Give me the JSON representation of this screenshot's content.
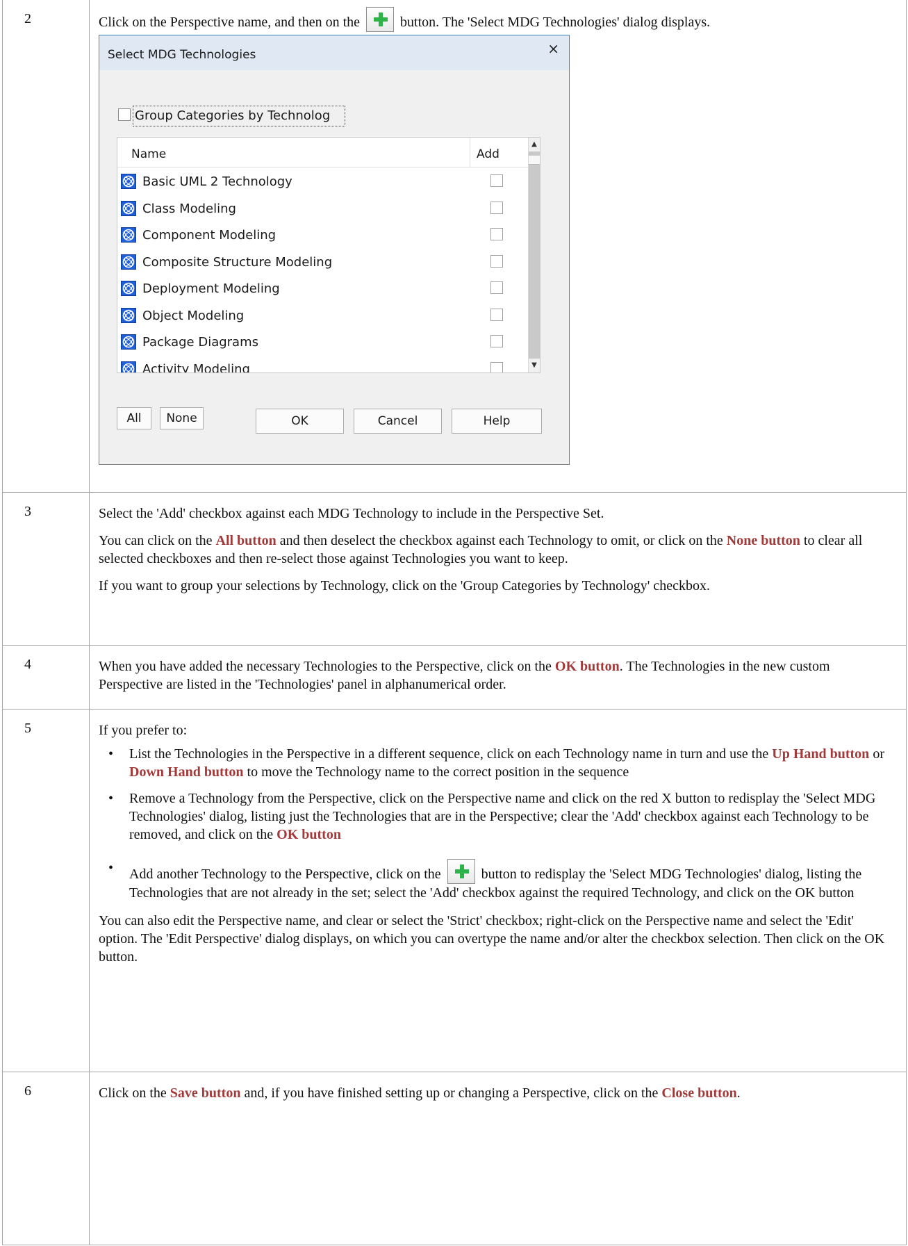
{
  "rows": [
    {
      "num": "2",
      "intro_before": "Click on the Perspective name, and then on the",
      "intro_after": "button. The 'Select MDG Technologies' dialog displays."
    },
    {
      "num": "3",
      "p1": "Select the 'Add' checkbox against each MDG Technology to include in the Perspective Set.",
      "p2_a": "You can click on the",
      "p2_all": "All button",
      "p2_b": "and then deselect the checkbox against each Technology to omit, or click on the",
      "p2_none": "None button",
      "p2_c": "to clear all selected checkboxes and then re-select those against Technologies you want to keep.",
      "p3": "If you want to group your selections by Technology, click on the 'Group Categories by Technology' checkbox."
    },
    {
      "num": "4",
      "p1_a": "When you have added the necessary Technologies to the Perspective, click on the",
      "p1_ok": "OK button",
      "p1_b": ". The Technologies in the new custom Perspective are listed in the 'Technologies' panel in alphanumerical order."
    },
    {
      "num": "5",
      "intro": "If you prefer to:",
      "b1_a": "List the Technologies in the Perspective in a different sequence, click on each Technology name in turn and use the",
      "b1_up": "Up Hand button",
      "b1_or": "or",
      "b1_down": "Down Hand button",
      "b1_b": "to move the Technology name to the correct position in the sequence",
      "b2_a": "Remove a Technology from the Perspective, click on the Perspective name and click on the red X button to redisplay the 'Select MDG Technologies' dialog, listing just the Technologies that are in the Perspective; clear the 'Add' checkbox against each Technology to be removed, and click on the",
      "b2_ok": "OK button",
      "b3_a": "Add another Technology to the Perspective, click on the",
      "b3_b": "button to redisplay the 'Select MDG Technologies' dialog, listing the Technologies that are not already in the set; select the 'Add' checkbox against the required Technology, and click on the OK button",
      "p_end": "You can also edit the Perspective name, and clear or select the 'Strict' checkbox; right-click on the Perspective name and select the 'Edit' option. The 'Edit Perspective' dialog displays, on which you can overtype the name and/or alter the checkbox selection. Then click on the OK button."
    },
    {
      "num": "6",
      "p1_a": "Click on the",
      "p1_save": "Save button",
      "p1_b": "and, if you have finished setting up or changing a Perspective, click on the",
      "p1_close": "Close button",
      "p1_c": "."
    }
  ],
  "dialog": {
    "title": "Select MDG Technologies",
    "close": "×",
    "group_label": "Group Categories by Technolog",
    "col_name": "Name",
    "col_add": "Add",
    "items": [
      "Basic UML 2 Technology",
      "Class Modeling",
      "Component Modeling",
      "Composite Structure Modeling",
      "Deployment Modeling",
      "Object Modeling",
      "Package Diagrams",
      "Activity Modeling"
    ],
    "btn_all": "All",
    "btn_none": "None",
    "btn_ok": "OK",
    "btn_cancel": "Cancel",
    "btn_help": "Help"
  },
  "colors": {
    "emphasis": "#a33a3a",
    "plus_icon": "#2db34a",
    "mdg_icon": "#1f5fd8"
  },
  "icons": {
    "add": "green-plus-icon",
    "technology": "mdg-technology-icon"
  }
}
